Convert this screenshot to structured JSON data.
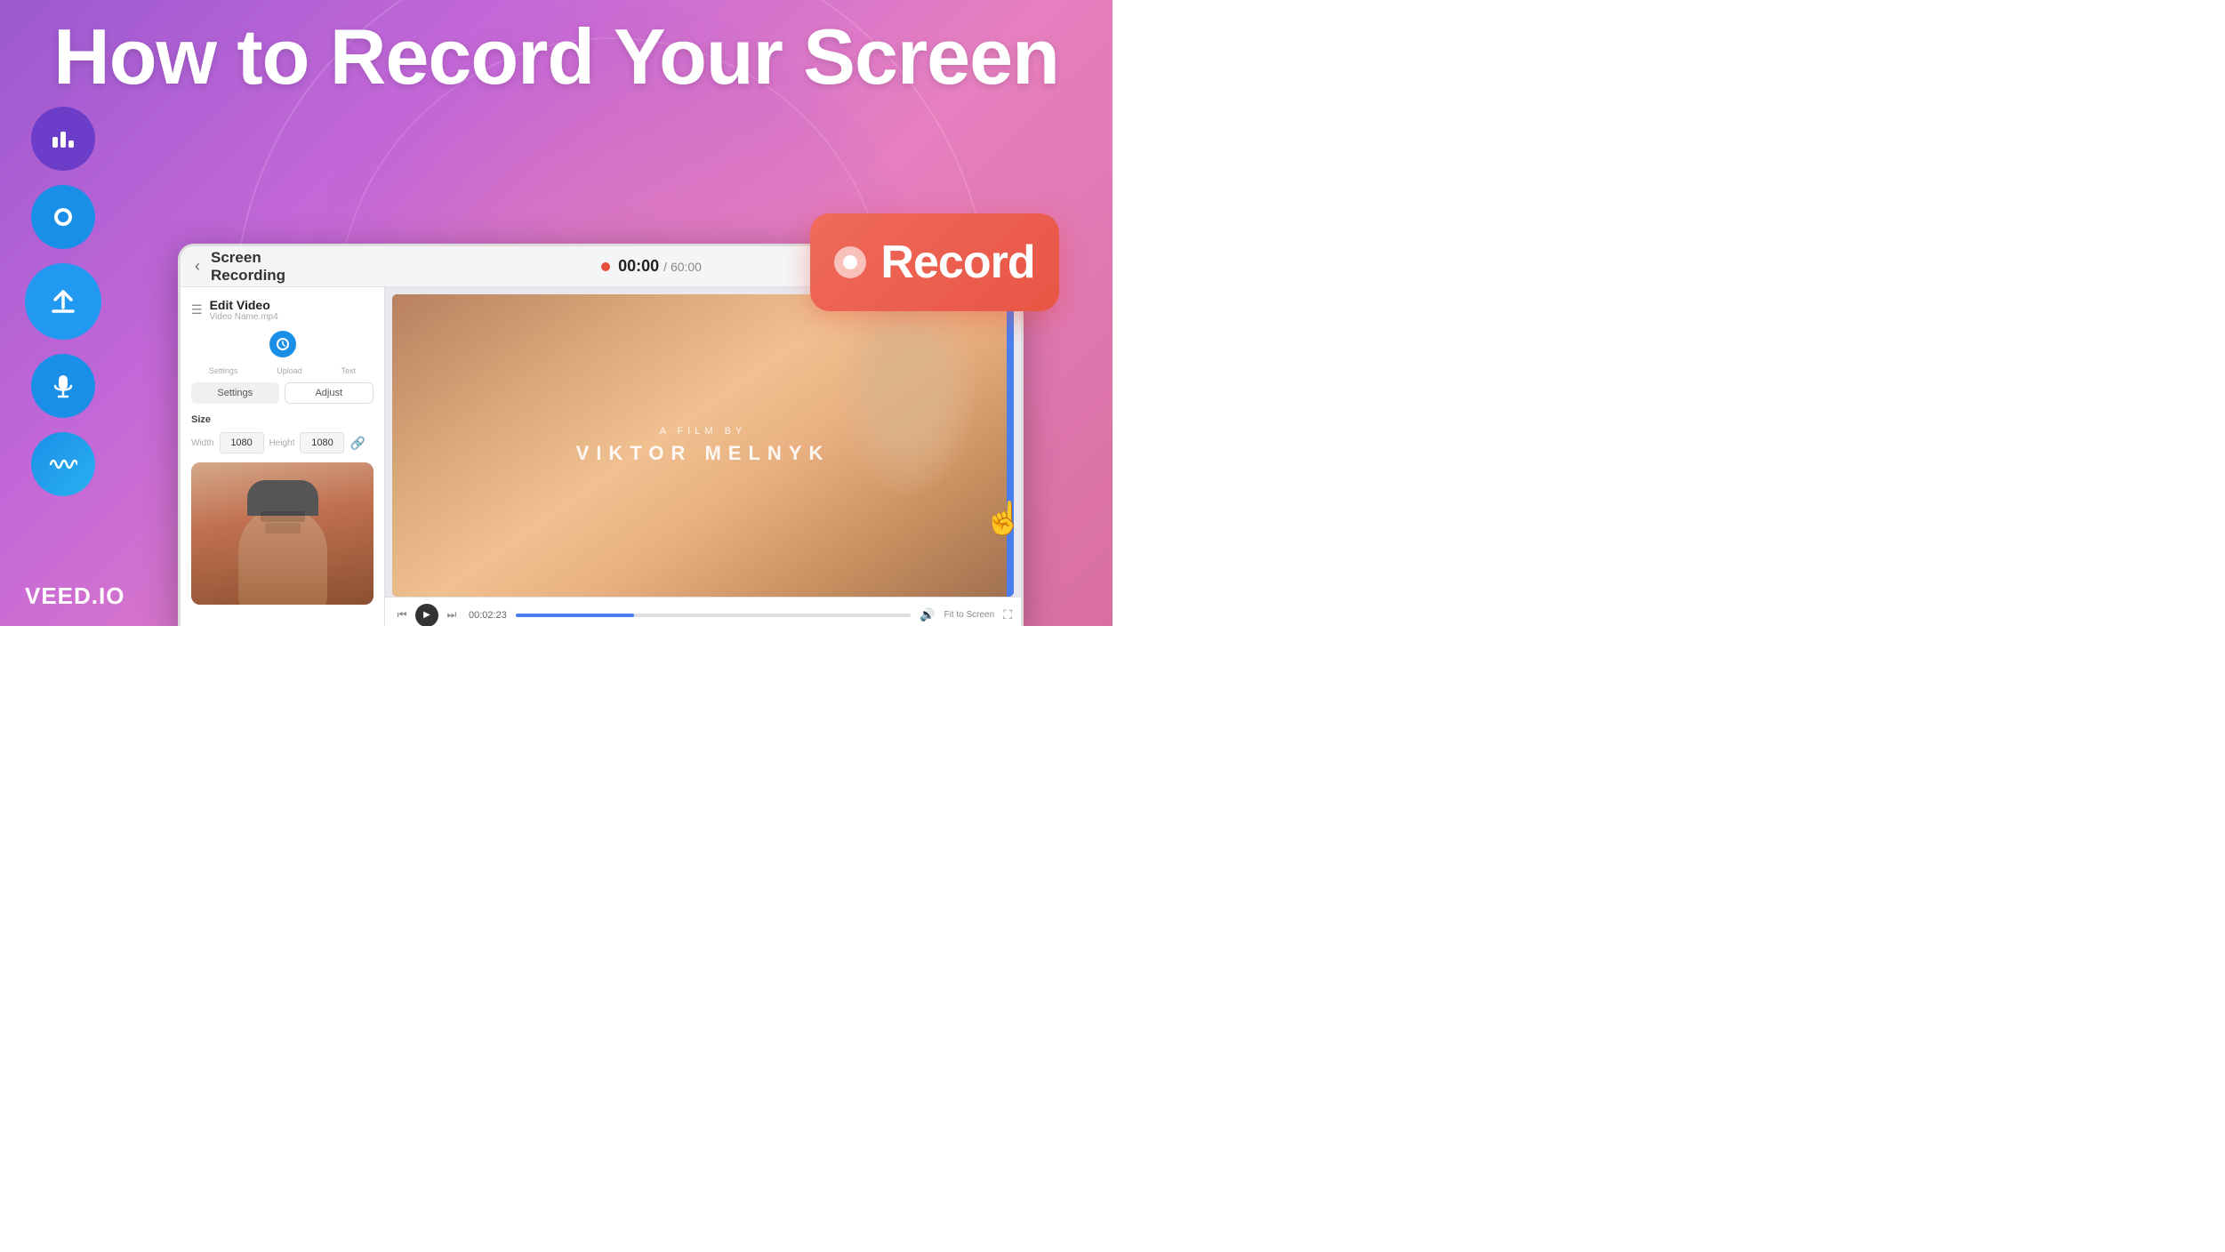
{
  "page": {
    "title": "How to Record Your Screen",
    "brand": "VEED.IO"
  },
  "header": {
    "back_label": "‹",
    "screen_recording_label": "Screen Recording",
    "timer_current": "00:00",
    "timer_separator": "/",
    "timer_total": "60:00"
  },
  "edit_panel": {
    "title": "Edit Video",
    "subtitle": "Video Name.mp4",
    "settings_btn": "Settings",
    "adjust_btn": "Adjust",
    "upload_label": "Upload",
    "text_label": "Text",
    "size_label": "Size",
    "width_label": "Width",
    "width_value": "1080",
    "height_label": "Height",
    "height_value": "1080"
  },
  "film_overlay": {
    "small_text": "A FILM BY",
    "large_text": "VIKTOR MELNYK"
  },
  "playback": {
    "timestamp": "00:02:23",
    "fit_screen": "Fit to Screen",
    "volume_icon": "🔊"
  },
  "record_button": {
    "label": "Record"
  },
  "sidebar_icons": [
    {
      "name": "chart-icon",
      "symbol": "📊",
      "bg": "purple"
    },
    {
      "name": "record-icon",
      "symbol": "⬤",
      "bg": "blue"
    },
    {
      "name": "upload-icon",
      "symbol": "↑",
      "bg": "blue"
    },
    {
      "name": "mic-icon",
      "symbol": "🎤",
      "bg": "blue"
    },
    {
      "name": "waveform-icon",
      "symbol": "∿",
      "bg": "blue"
    }
  ]
}
